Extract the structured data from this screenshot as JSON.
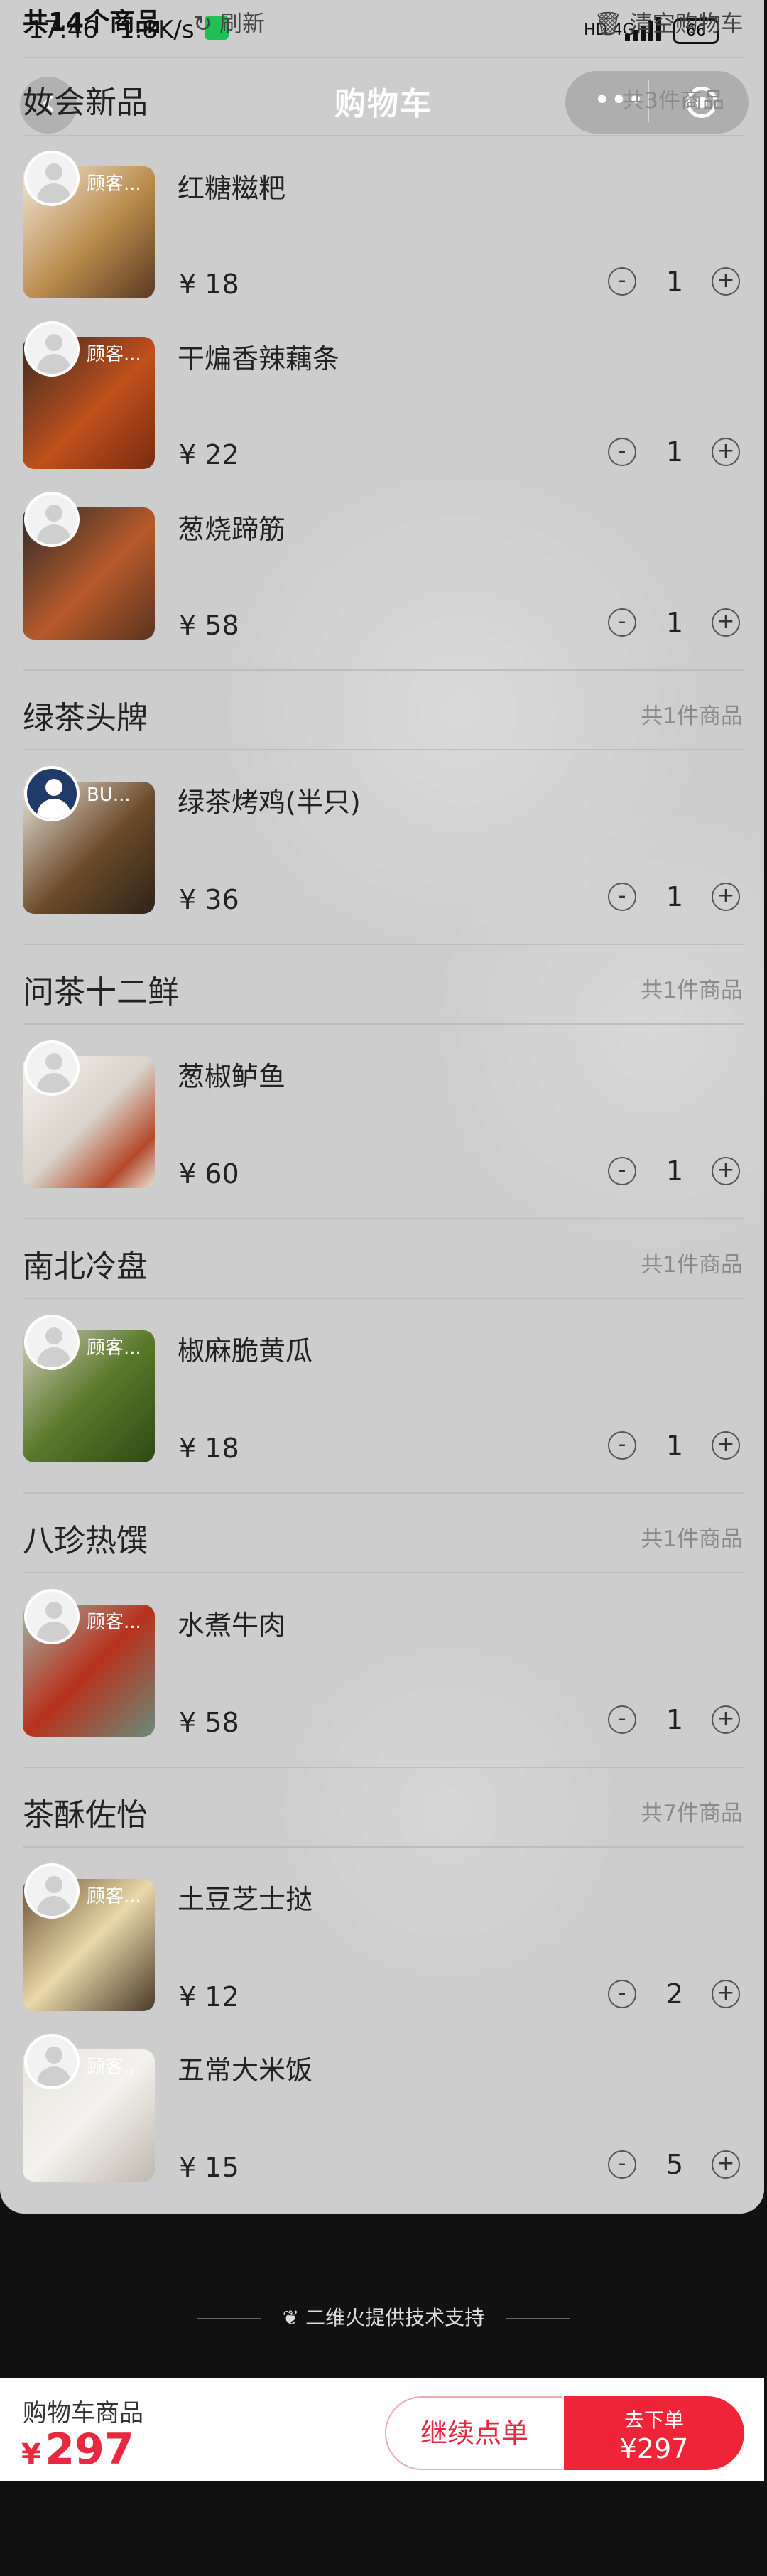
{
  "status_bar": {
    "time": "17:46",
    "speed": "1.8K/s",
    "battery": "66",
    "net": "HD 4G"
  },
  "header": {
    "total_items": "共14个商品",
    "refresh": "刷新",
    "clear": "清空购物车",
    "title": "购物车",
    "back_icon": "chevron-left-icon",
    "more_icon": "more-dots-icon",
    "close_icon": "target-circle-icon"
  },
  "groups": [
    {
      "title": "奻会新品",
      "count": "共3件商品",
      "items": [
        {
          "name": "红糖糍粑",
          "price": "18",
          "qty": "1",
          "avatar_label": "顾客..."
        },
        {
          "name": "干煸香辣藕条",
          "price": "22",
          "qty": "1",
          "avatar_label": "顾客..."
        },
        {
          "name": "葱烧蹄筋",
          "price": "58",
          "qty": "1",
          "avatar_label": ""
        }
      ]
    },
    {
      "title": "绿茶头牌",
      "count": "共1件商品",
      "items": [
        {
          "name": "绿茶烤鸡(半只)",
          "price": "36",
          "qty": "1",
          "avatar_label": "BU..."
        }
      ]
    },
    {
      "title": "问茶十二鲜",
      "count": "共1件商品",
      "items": [
        {
          "name": "葱椒鲈鱼",
          "price": "60",
          "qty": "1",
          "avatar_label": ""
        }
      ]
    },
    {
      "title": "南北冷盘",
      "count": "共1件商品",
      "items": [
        {
          "name": "椒麻脆黄瓜",
          "price": "18",
          "qty": "1",
          "avatar_label": "顾客..."
        }
      ]
    },
    {
      "title": "八珍热馔",
      "count": "共1件商品",
      "items": [
        {
          "name": "水煮牛肉",
          "price": "58",
          "qty": "1",
          "avatar_label": "顾客..."
        }
      ]
    },
    {
      "title": "茶酥佐怡",
      "count": "共7件商品",
      "items": [
        {
          "name": "土豆芝士挞",
          "price": "12",
          "qty": "2",
          "avatar_label": "顾客..."
        },
        {
          "name": "五常大米饭",
          "price": "15",
          "qty": "5",
          "avatar_label": "顾客..."
        }
      ]
    }
  ],
  "currency": "¥",
  "minus": "-",
  "plus": "+",
  "footer": {
    "powered_by": "二维火提供技术支持"
  },
  "bottom": {
    "label": "购物车商品",
    "currency": "¥",
    "total": "297",
    "continue": "继续点单",
    "order_label": "去下单",
    "order_amount": "¥297"
  },
  "colors": {
    "accent": "#f02438",
    "sheet": "#cdcdcd"
  }
}
